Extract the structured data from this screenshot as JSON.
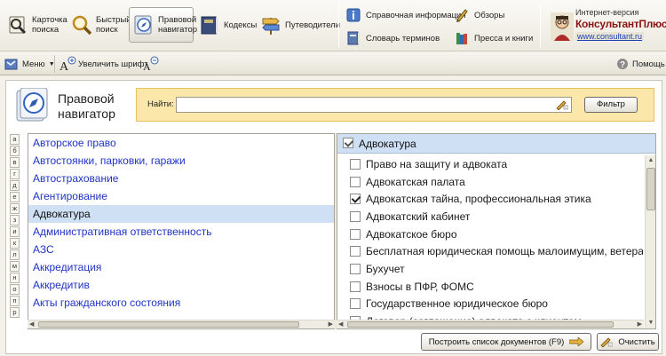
{
  "toolbar": {
    "buttons": [
      {
        "label": "Карточка\nпоиска",
        "icon": "search-card-icon"
      },
      {
        "label": "Быстрый\nпоиск",
        "icon": "magnifier-icon"
      },
      {
        "label": "Правовой\nнавигатор",
        "icon": "compass-icon"
      },
      {
        "label": "Кодексы",
        "icon": "codex-book-icon"
      },
      {
        "label": "Путеводители",
        "icon": "signpost-icon"
      }
    ],
    "secondary": [
      {
        "label": "Справочная информация",
        "icon": "info-icon"
      },
      {
        "label": "Обзоры",
        "icon": "pen-icon"
      },
      {
        "label": "Словарь терминов",
        "icon": "dictionary-icon"
      },
      {
        "label": "Пресса и книги",
        "icon": "books-icon"
      }
    ],
    "brand": {
      "line1": "Интернет-версия",
      "name": "КонсультантПлюс",
      "url": "www.consultant.ru"
    }
  },
  "bar2": {
    "menu": "Меню",
    "font_increase": "Увеличить шрифт",
    "help": "Помощь"
  },
  "navigator": {
    "title": "Правовой\nнавигатор",
    "search_label": "Найти:",
    "search_value": "",
    "filter_button": "Фильтр"
  },
  "alphabet": [
    "а",
    "б",
    "в",
    "г",
    "д",
    "е",
    "ж",
    "з",
    "и",
    "к",
    "л",
    "м",
    "н",
    "о",
    "п",
    "р"
  ],
  "left_list": [
    {
      "label": "Авторское право",
      "selected": false
    },
    {
      "label": "Автостоянки, парковки, гаражи",
      "selected": false
    },
    {
      "label": "Автострахование",
      "selected": false
    },
    {
      "label": "Агентирование",
      "selected": false
    },
    {
      "label": "Адвокатура",
      "selected": true
    },
    {
      "label": "Административная ответственность",
      "selected": false
    },
    {
      "label": "АЗС",
      "selected": false
    },
    {
      "label": "Аккредитация",
      "selected": false
    },
    {
      "label": "Аккредитив",
      "selected": false
    },
    {
      "label": "Акты гражданского состояния",
      "selected": false
    }
  ],
  "right_panel": {
    "header": "Адвокатура",
    "items": [
      {
        "label": "Право на защиту и адвоката",
        "checked": false
      },
      {
        "label": "Адвокатская палата",
        "checked": false
      },
      {
        "label": "Адвокатская тайна, профессиональная этика",
        "checked": true
      },
      {
        "label": "Адвокатский кабинет",
        "checked": false
      },
      {
        "label": "Адвокатское бюро",
        "checked": false
      },
      {
        "label": "Бесплатная юридическая помощь малоимущим, ветеран...",
        "checked": false
      },
      {
        "label": "Бухучет",
        "checked": false
      },
      {
        "label": "Взносы в ПФР, ФОМС",
        "checked": false
      },
      {
        "label": "Государственное юридическое бюро",
        "checked": false
      },
      {
        "label": "Договор (соглашение) адвоката с клиентом",
        "checked": false
      }
    ]
  },
  "bottom": {
    "build_button": "Построить список документов (F9)",
    "clear_button": "Очистить"
  },
  "colors": {
    "link_blue": "#1f33c4",
    "selection": "#cfe0f5",
    "search_bg": "#fbe7a9",
    "brand_red": "#8a1414"
  }
}
